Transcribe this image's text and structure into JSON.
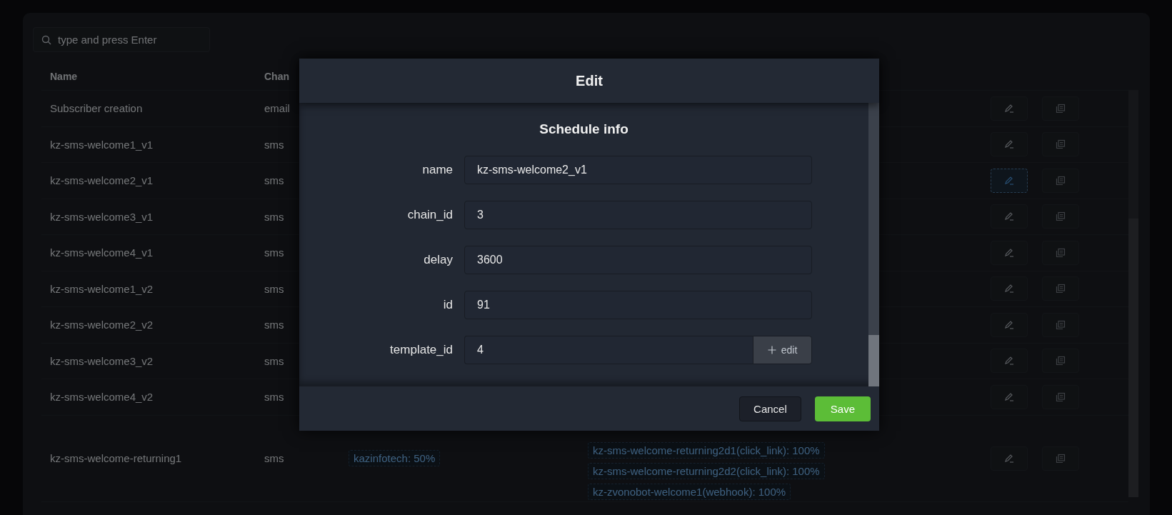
{
  "search": {
    "placeholder": "type and press Enter"
  },
  "table": {
    "columns": [
      "Name",
      "Chan"
    ],
    "rows": [
      {
        "name": "Subscriber creation",
        "channel": "email",
        "edit_focused": false
      },
      {
        "name": "kz-sms-welcome1_v1",
        "channel": "sms",
        "edit_focused": false
      },
      {
        "name": "kz-sms-welcome2_v1",
        "channel": "sms",
        "edit_focused": true
      },
      {
        "name": "kz-sms-welcome3_v1",
        "channel": "sms",
        "edit_focused": false
      },
      {
        "name": "kz-sms-welcome4_v1",
        "channel": "sms",
        "edit_focused": false
      },
      {
        "name": "kz-sms-welcome1_v2",
        "channel": "sms",
        "edit_focused": false
      },
      {
        "name": "kz-sms-welcome2_v2",
        "channel": "sms",
        "edit_focused": false
      },
      {
        "name": "kz-sms-welcome3_v2",
        "channel": "sms",
        "edit_focused": false
      },
      {
        "name": "kz-sms-welcome4_v2",
        "channel": "sms",
        "edit_focused": false
      },
      {
        "name": "kz-sms-welcome-returning1",
        "channel": "sms",
        "edit_focused": false,
        "tags": [
          "kazinfotech: 50%"
        ],
        "next_steps": [
          "kz-sms-welcome-returning2d1(click_link): 100%",
          "kz-sms-welcome-returning2d2(click_link): 100%",
          "kz-zvonobot-welcome1(webhook): 100%"
        ]
      }
    ]
  },
  "modal": {
    "title": "Edit",
    "section_title": "Schedule info",
    "fields": [
      {
        "label": "name",
        "value": "kz-sms-welcome2_v1"
      },
      {
        "label": "chain_id",
        "value": "3"
      },
      {
        "label": "delay",
        "value": "3600"
      },
      {
        "label": "id",
        "value": "91"
      },
      {
        "label": "template_id",
        "value": "4",
        "action": "edit"
      }
    ],
    "buttons": [
      {
        "label": "Cancel",
        "kind": "secondary"
      },
      {
        "label": "Save",
        "kind": "primary"
      }
    ]
  }
}
